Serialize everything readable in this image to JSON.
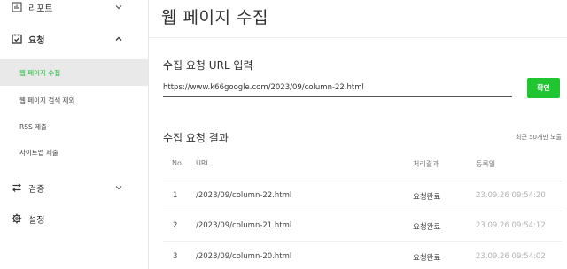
{
  "sidebar": {
    "report": {
      "label": "리포트",
      "icon": "chart-icon"
    },
    "request": {
      "label": "요청",
      "icon": "checkbox-icon",
      "items": [
        {
          "label": "웹 페이지 수집",
          "active": true
        },
        {
          "label": "웹 페이지 검색 제외",
          "active": false
        },
        {
          "label": "RSS 제출",
          "active": false
        },
        {
          "label": "사이트맵 제출",
          "active": false
        }
      ]
    },
    "verify": {
      "label": "검증",
      "icon": "arrows-icon"
    },
    "settings": {
      "label": "설정",
      "icon": "gear-icon"
    }
  },
  "main": {
    "title": "웹 페이지 수집",
    "input_section": {
      "label": "수집 요청 URL 입력",
      "url_value": "https://www.k66google.com/2023/09/column-22.html",
      "confirm_label": "확인"
    },
    "results": {
      "label": "수집 요청 결과",
      "note": "최근 50개만 노출",
      "columns": {
        "no": "No",
        "url": "URL",
        "status": "처리결과",
        "date": "등록일"
      },
      "rows": [
        {
          "no": "1",
          "url": "/2023/09/column-22.html",
          "status": "요청완료",
          "date": "23.09.26 09:54:20"
        },
        {
          "no": "2",
          "url": "/2023/09/column-21.html",
          "status": "요청완료",
          "date": "23.09.26 09:54:12"
        },
        {
          "no": "3",
          "url": "/2023/09/column-20.html",
          "status": "요청완료",
          "date": "23.09.26 09:54:02"
        }
      ]
    }
  },
  "colors": {
    "accent": "#21c531",
    "active_text": "#1fbf3a",
    "active_bg": "#e9e9e9",
    "date_text": "#b3b3b3"
  }
}
